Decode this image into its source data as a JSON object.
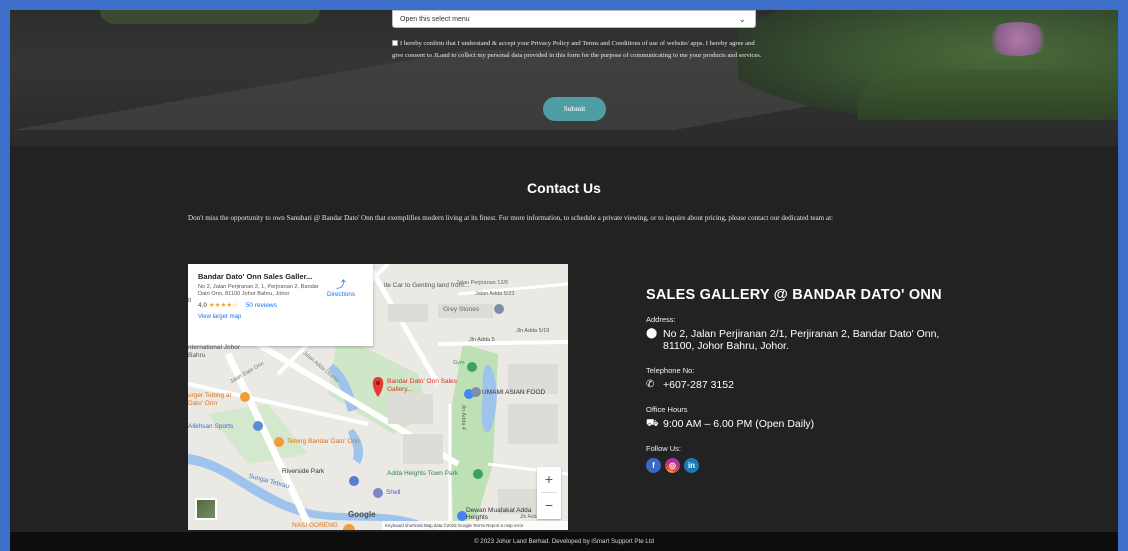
{
  "form": {
    "select_value": "Open this select menu",
    "consent_text": "I hereby confirm that I understand & accept your Privacy Policy and Terms and Conditions of use of website/ apps. I hereby agree and give consent to JLand to collect my personal data provided in this form for the purpose of communicating to me your products and services.",
    "submit_label": "Submit"
  },
  "contact": {
    "heading": "Contact Us",
    "intro": "Don't miss the opportunity to own Sanubari @ Bandar Dato' Onn that exemplifies modern living at its finest. For more information, to schedule a private viewing, or to inquire about pricing, please contact our dedicated team at:"
  },
  "map": {
    "place_title": "Bandar Dato' Onn Sales Galler...",
    "place_address": "No 2, Jalan Perjiranan 2, 1, Perjiranan 2, Bandar Dato Onn, 81100 Johor Bahru, Johor",
    "rating": "4.0",
    "stars": "★★★★☆",
    "reviews": "50 reviews",
    "directions": "Directions",
    "view_larger": "View larger map",
    "labels": {
      "pin": "Bandar Dato' Onn Sales Gallery...",
      "grey_stones": "Grey Stones",
      "umami": "UMAMI ASIAN FOOD",
      "gym": "Gym",
      "tebing": "Tebing Bandar Dato' Onn",
      "burger": "urger Tebing ar Dato' Onn",
      "alikhsan": "Alikhsan Sports",
      "riverside": "Riverside Park",
      "sungai": "Sungai Tebrau",
      "adda_park": "Adda Heights Town Park",
      "shell": "Shell",
      "nasi": "NASI GORENG",
      "dewan": "Dewan Muafakat Adda Heights",
      "kite": "ite Car to Genting land from...",
      "jalan_perjiranan": "Jalan Perjiranan 12/8",
      "jalan_adda523": "Jalan Adda 5/23",
      "jln_adda519": "Jln Adda 5/19",
      "jln_adda5": "Jln Adda 5",
      "international": "nternational Johor Bahru",
      "jalan_dato_onn": "Jalan Dato Onn",
      "jalan_adda_utama": "Jalan Adda Utama",
      "jln_adda4": "Jln Adda 4",
      "jln_adda": "Jln Adda",
      "jalan_adda_5": "Jln Adda 5",
      "left_tl": "ti"
    },
    "google": "Google",
    "attribution": "Keyboard shortcuts   Map data ©2023 Google   Terms   Report a map error",
    "zoom_in": "+",
    "zoom_out": "−"
  },
  "info": {
    "title": "SALES GALLERY @ BANDAR DATO' ONN",
    "address_label": "Address:",
    "address": "No 2, Jalan Perjiranan 2/1, Perjiranan 2, Bandar Dato' Onn, 81100, Johor Bahru, Johor.",
    "phone_label": "Telephone No:",
    "phone": "+607-287 3152",
    "hours_label": "Office Hours",
    "hours": "9:00 AM – 6.00 PM (Open Daily)",
    "follow_label": "Follow Us:",
    "social": [
      "f",
      "◎",
      "in"
    ]
  },
  "footer": {
    "text": "© 2023 Johor Land Berhad. Developed by iSmart Support Pte Ltd"
  },
  "colors": {
    "background_border": "#3d6fc9",
    "page_dark": "#222222",
    "submit_button": "#4f9ea3",
    "footer": "#0d0d0d"
  }
}
